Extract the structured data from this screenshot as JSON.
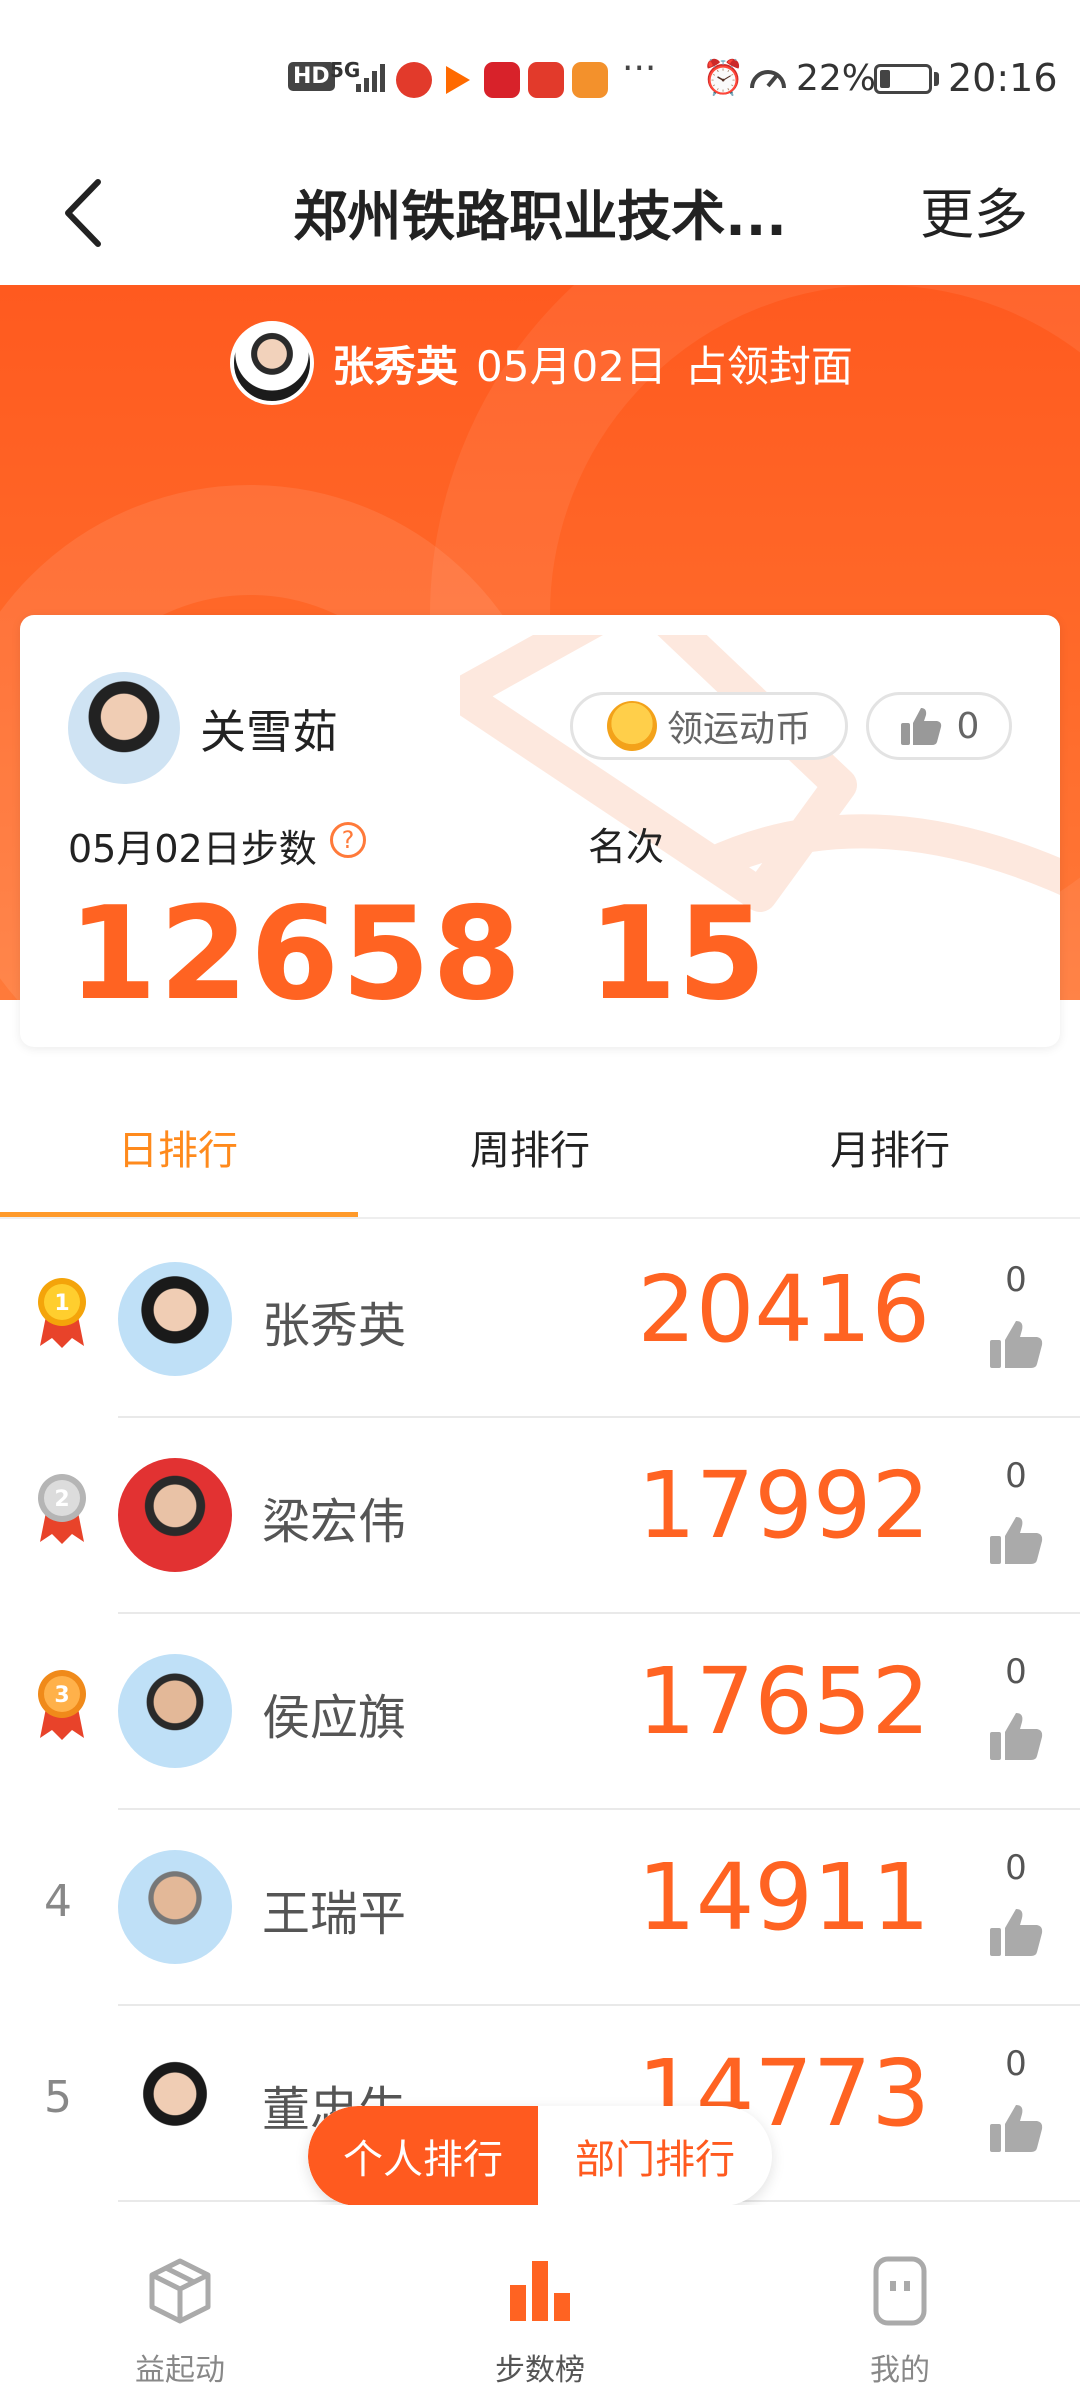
{
  "status_bar": {
    "hd": "HD",
    "network": "5G",
    "dots": "···",
    "battery_percent": "22%",
    "battery_level": 0.22,
    "time": "20:16",
    "app_icon_colors": [
      "#e23a2b",
      "#ff6a00",
      "#d8222a",
      "#e23a2b",
      "#f3912c"
    ]
  },
  "header": {
    "back_icon": "chevron-left-icon",
    "title": "郑州铁路职业技术...",
    "more": "更多"
  },
  "cover": {
    "name": "张秀英",
    "date": "05月02日",
    "claim": "占领封面"
  },
  "me": {
    "name": "关雪茹",
    "coin_button": "领运动币",
    "likes": "0",
    "steps_label": "05月02日步数",
    "help_icon": "?",
    "rank_label": "名次",
    "steps": "12658",
    "rank": "15"
  },
  "tabs": [
    {
      "label": "日排行",
      "active": true
    },
    {
      "label": "周排行",
      "active": false
    },
    {
      "label": "月排行",
      "active": false
    }
  ],
  "ranking": [
    {
      "rank": "1",
      "medal": "gold",
      "name": "张秀英",
      "steps": "20416",
      "likes": "0"
    },
    {
      "rank": "2",
      "medal": "silver",
      "name": "梁宏伟",
      "steps": "17992",
      "likes": "0"
    },
    {
      "rank": "3",
      "medal": "bronze",
      "name": "侯应旗",
      "steps": "17652",
      "likes": "0"
    },
    {
      "rank": "4",
      "medal": "",
      "name": "王瑞平",
      "steps": "14911",
      "likes": "0"
    },
    {
      "rank": "5",
      "medal": "",
      "name": "董忠生",
      "steps": "14773",
      "likes": "0"
    }
  ],
  "toggle": {
    "personal": "个人排行",
    "department": "部门排行"
  },
  "bottom_nav": [
    {
      "label": "益起动",
      "icon": "box-icon",
      "active": false
    },
    {
      "label": "步数榜",
      "icon": "bar-chart-icon",
      "active": true
    },
    {
      "label": "我的",
      "icon": "profile-icon",
      "active": false
    }
  ],
  "colors": {
    "accent": "#ff6322",
    "hero": "#ff5a1f",
    "tab_active": "#ff8a1c"
  }
}
